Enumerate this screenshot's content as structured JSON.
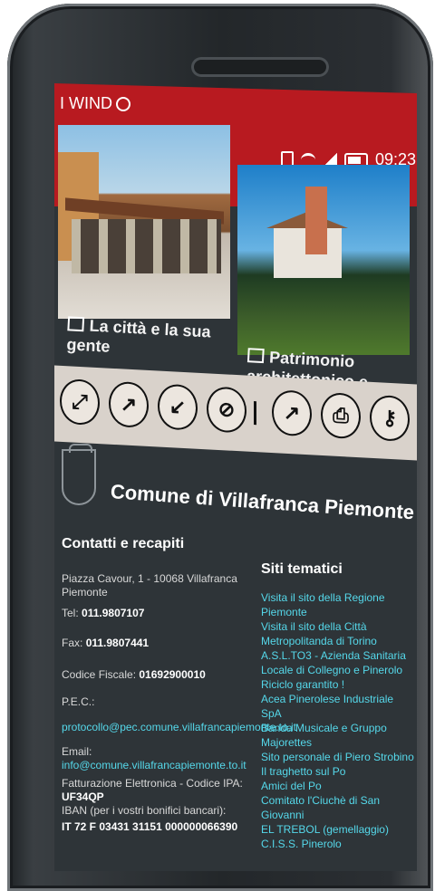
{
  "status": {
    "carrier": "I WIND",
    "time": "09:23"
  },
  "tiles": [
    {
      "caption": "La città e la sua gente"
    },
    {
      "caption": "Patrimonio architettonico e culturale"
    }
  ],
  "toolbar": {
    "buttons": [
      "fullscreen-icon",
      "expand-icon",
      "shrink-icon",
      "hide-icon",
      "chart-icon",
      "print-icon",
      "key-icon"
    ]
  },
  "header": {
    "title": "Comune di Villafranca Piemonte"
  },
  "contacts": {
    "title": "Contatti e recapiti",
    "address": "Piazza Cavour, 1 - 10068 Villafranca Piemonte",
    "tel_label": "Tel:",
    "tel": "011.9807107",
    "fax_label": "Fax:",
    "fax": "011.9807441",
    "cf_label": "Codice Fiscale:",
    "cf": "01692900010",
    "pec_label": "P.E.C.:",
    "pec": "protocollo@pec.comune.villafrancapiemonte.to.it",
    "email_label": "Email:",
    "email": "info@comune.villafrancapiemonte.to.it",
    "fe_label": "Fatturazione Elettronica - Codice IPA:",
    "fe": "UF34QP",
    "iban_label": "IBAN (per i vostri bonifici bancari):",
    "iban": "IT 72 F 03431 31151 000000066390"
  },
  "themed": {
    "title": "Siti tematici",
    "links": [
      "Visita il sito della Regione Piemonte",
      "Visita il sito della Città Metropolitanda di Torino",
      "A.S.L.TO3 - Azienda Sanitaria Locale di Collegno e Pinerolo",
      "Riciclo garantito !",
      "Acea Pinerolese Industriale SpA",
      "Banda Musicale e Gruppo Majorettes",
      "Sito personale di Piero Strobino",
      "Il traghetto sul Po",
      "Amici del Po",
      "Comitato l'Ciuchè di San Giovanni",
      "EL TREBOL (gemellaggio)",
      "C.I.S.S. Pinerolo"
    ]
  }
}
